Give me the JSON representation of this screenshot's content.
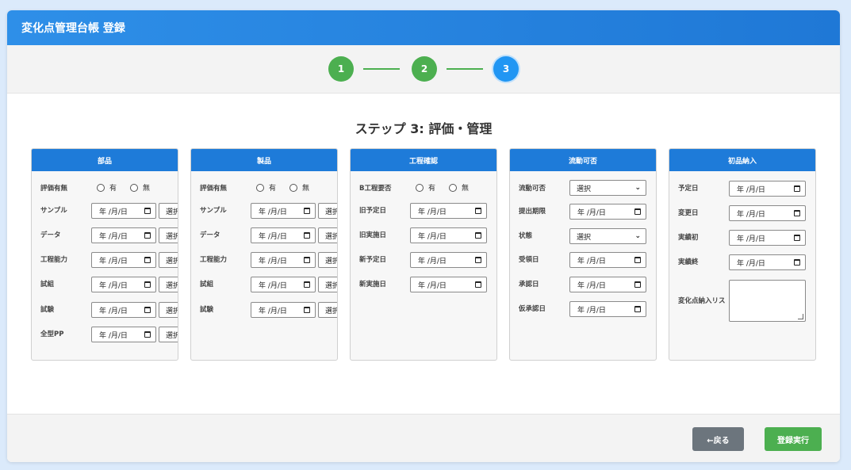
{
  "header": {
    "title": "変化点管理台帳 登録"
  },
  "stepper": {
    "steps": [
      "1",
      "2",
      "3"
    ],
    "colors": {
      "done": "#4caf50",
      "active": "#2196f3"
    }
  },
  "step_title": "ステップ 3: 評価・管理",
  "date_placeholder": "年 /月/日",
  "select_placeholder": "選択",
  "radio": {
    "yes": "有",
    "no": "無"
  },
  "panels": {
    "parts": {
      "title": "部品",
      "rows": [
        "評価有無",
        "サンプル",
        "データ",
        "工程能力",
        "試組",
        "試験",
        "全型PP"
      ]
    },
    "product": {
      "title": "製品",
      "rows": [
        "評価有無",
        "サンプル",
        "データ",
        "工程能力",
        "試組",
        "試験"
      ]
    },
    "process": {
      "title": "工程確認",
      "rows": [
        "B工程要否",
        "旧予定日",
        "旧実施日",
        "新予定日",
        "新実施日"
      ]
    },
    "flow": {
      "title": "流動可否",
      "rows": [
        "流動可否",
        "提出期限",
        "状態",
        "受領日",
        "承認日",
        "仮承認日"
      ]
    },
    "initial": {
      "title": "初品納入",
      "rows": [
        "予定日",
        "変更日",
        "実績初",
        "実績終",
        "変化点納入リス"
      ]
    }
  },
  "footer": {
    "back_label": "←戻る",
    "submit_label": "登録実行"
  },
  "icons": [
    "calendar-icon",
    "chevron-down-icon",
    "radio-icon",
    "resize-grip-icon"
  ]
}
